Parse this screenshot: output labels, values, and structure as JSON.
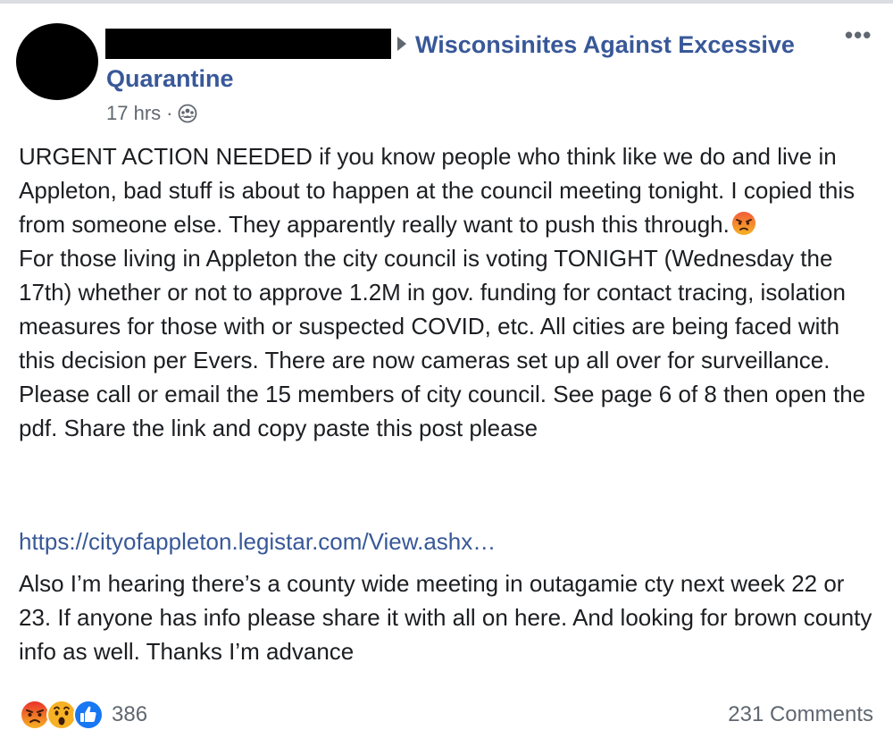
{
  "post": {
    "group_name_line1": "Wisconsinites Against Excessive",
    "group_name_line2": "Quarantine",
    "timestamp": "17 hrs",
    "separator": "·",
    "audience_icon": "group-icon",
    "body_paragraph_1": "URGENT ACTION NEEDED if you know people who think like we do and live in Appleton, bad stuff is about to happen at the council meeting tonight. I copied this from someone else. They apparently really want to push this through.",
    "body_paragraph_2": "For those living in Appleton the city council is voting TONIGHT (Wednesday the 17th) whether or not to approve 1.2M in gov. funding for contact tracing, isolation measures for those with or suspected COVID, etc. All cities are being faced with this decision per Evers. There are now cameras set up all over for surveillance. Please call or email the 15 members of city council. See page 6 of 8 then open the pdf. Share the link and copy paste this post please",
    "link_text": "https://cityofappleton.legistar.com/View.ashx…",
    "body_paragraph_3": "Also I’m hearing there’s a county wide meeting in outagamie cty next week 22 or 23. If anyone has info please share it with all on here. And looking for brown county info as well. Thanks I’m advance",
    "inline_emoji": "angry-emoji"
  },
  "footer": {
    "reaction_icons": [
      "angry-reaction-icon",
      "wow-reaction-icon",
      "like-reaction-icon"
    ],
    "reaction_count": "386",
    "comments_label": "231 Comments"
  },
  "menu": {
    "more_label": "•••"
  },
  "colors": {
    "link_blue": "#385898",
    "text": "#1c1e21",
    "meta_gray": "#606770",
    "like_blue": "#1877f2",
    "angry_orange": "#e9710f",
    "wow_yellow": "#f7b125"
  }
}
